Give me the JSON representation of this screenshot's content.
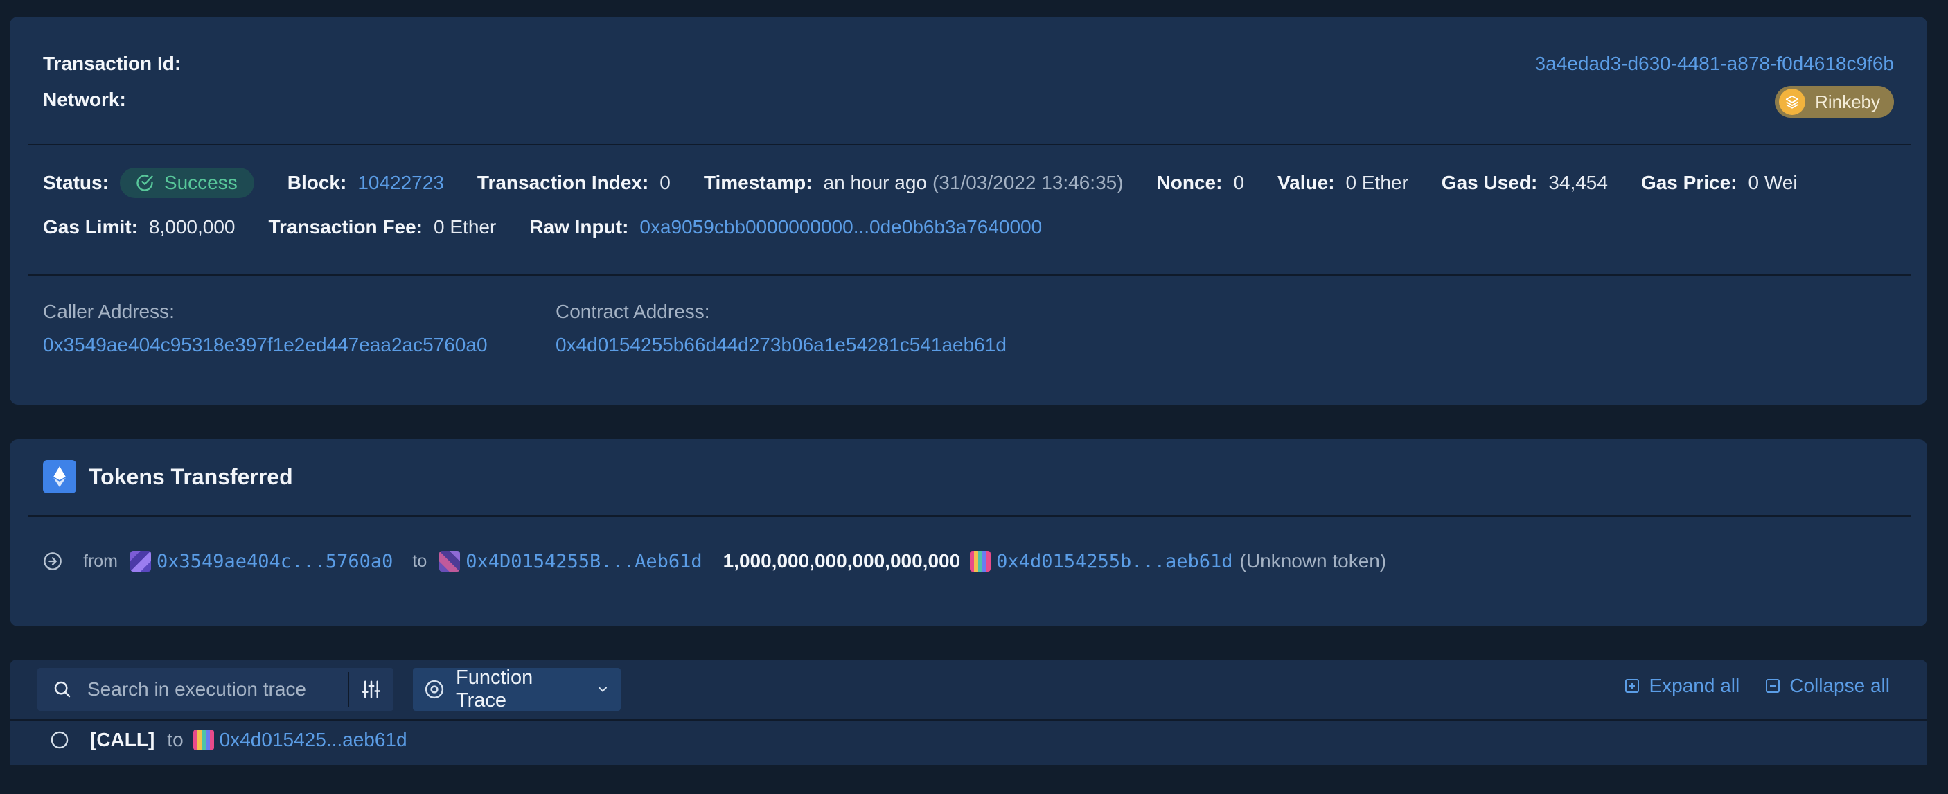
{
  "tx": {
    "id_label": "Transaction Id:",
    "id_value": "3a4edad3-d630-4481-a878-f0d4618c9f6b",
    "network_label": "Network:",
    "network_value": "Rinkeby",
    "status_label": "Status:",
    "status_value": "Success",
    "block_label": "Block:",
    "block_value": "10422723",
    "index_label": "Transaction Index:",
    "index_value": "0",
    "timestamp_label": "Timestamp:",
    "timestamp_relative": "an hour ago",
    "timestamp_absolute": "(31/03/2022 13:46:35)",
    "nonce_label": "Nonce:",
    "nonce_value": "0",
    "value_label": "Value:",
    "value_value": "0 Ether",
    "gas_used_label": "Gas Used:",
    "gas_used_value": "34,454",
    "gas_price_label": "Gas Price:",
    "gas_price_value": "0 Wei",
    "gas_limit_label": "Gas Limit:",
    "gas_limit_value": "8,000,000",
    "fee_label": "Transaction Fee:",
    "fee_value": "0 Ether",
    "raw_input_label": "Raw Input:",
    "raw_input_value": "0xa9059cbb0000000000...0de0b6b3a7640000",
    "caller_label": "Caller Address:",
    "caller_value": "0x3549ae404c95318e397f1e2ed447eaa2ac5760a0",
    "contract_label": "Contract Address:",
    "contract_value": "0x4d0154255b66d44d273b06a1e54281c541aeb61d"
  },
  "tokens": {
    "title": "Tokens Transferred",
    "transfers": [
      {
        "from_label": "from",
        "from_address": "0x3549ae404c...5760a0",
        "to_label": "to",
        "to_address": "0x4D0154255B...Aeb61d",
        "amount": "1,000,000,000,000,000,000",
        "token_address": "0x4d0154255b...aeb61d",
        "token_name": "(Unknown token)"
      }
    ]
  },
  "trace": {
    "search_placeholder": "Search in execution trace",
    "mode_label": "Function Trace",
    "expand_all": "Expand all",
    "collapse_all": "Collapse all",
    "calls": [
      {
        "type": "[CALL]",
        "to_label": "to",
        "address": "0x4d015425...aeb61d"
      }
    ]
  },
  "colors": {
    "background": "#111d2c",
    "panel": "#1b3150",
    "link": "#5b9de6",
    "success": "#58c79a",
    "network_badge": "#8e7c4a",
    "eth_icon_bg": "#3e82e8"
  },
  "icons": [
    "layers-icon",
    "check-circle-icon",
    "ethereum-icon",
    "arrow-right-circle-icon",
    "search-icon",
    "sliders-icon",
    "target-icon",
    "chevron-down-icon",
    "plus-square-icon",
    "minus-square-icon",
    "circle-icon",
    "identicon"
  ]
}
